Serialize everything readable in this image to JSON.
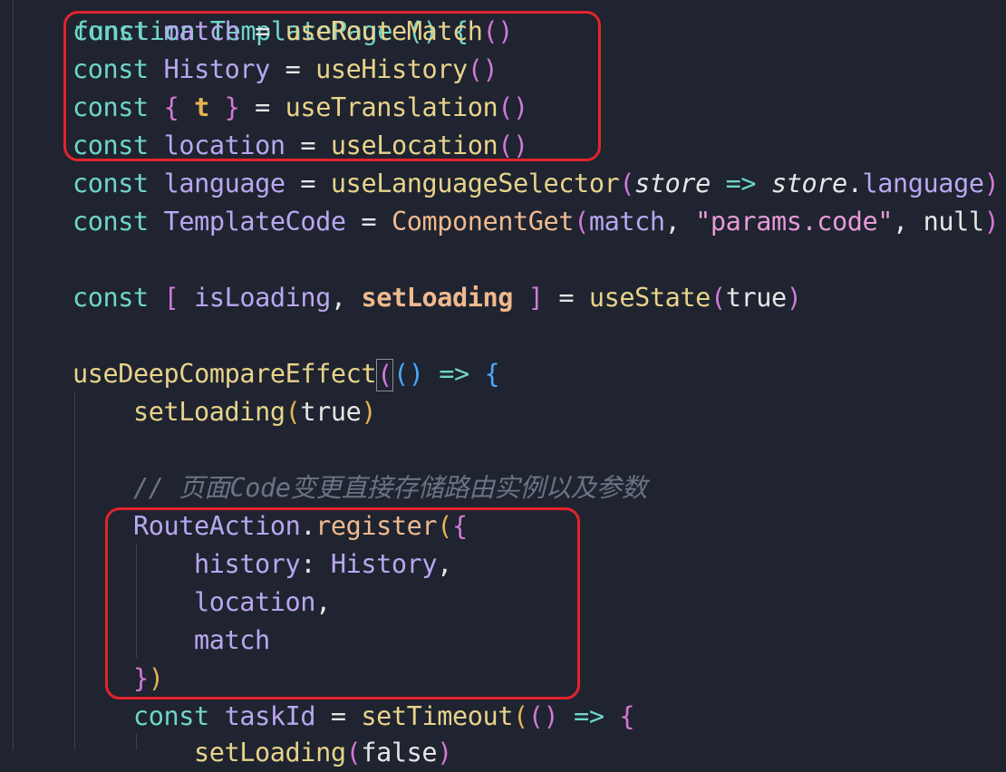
{
  "editor": {
    "top_partial": "function TemplatePage () {",
    "lines": [
      {
        "tokens": [
          "const ",
          "match",
          " = ",
          "useRouteMatch",
          "()"
        ]
      },
      {
        "tokens": [
          "const ",
          "History",
          " = ",
          "useHistory",
          "()"
        ]
      },
      {
        "tokens": [
          "const ",
          "{ ",
          "t",
          " }",
          " = ",
          "useTranslation",
          "()"
        ]
      },
      {
        "tokens": [
          "const ",
          "location",
          " = ",
          "useLocation",
          "()"
        ]
      },
      {
        "tokens": [
          "const ",
          "language",
          " = ",
          "useLanguageSelector",
          "(",
          "store",
          " => ",
          "store",
          ".",
          "language",
          ")"
        ]
      },
      {
        "tokens": [
          "const ",
          "TemplateCode",
          " = ",
          "ComponentGet",
          "(",
          "match",
          ", ",
          "\"params.code\"",
          ", ",
          "null",
          ")"
        ]
      },
      {
        "tokens": [
          "const ",
          "[ ",
          "isLoading",
          ", ",
          "setLoading",
          " ]",
          " = ",
          "useState",
          "(",
          "true",
          ")"
        ]
      },
      {
        "tokens": [
          "useDeepCompareEffect",
          "(",
          "()",
          " => ",
          "{"
        ]
      },
      {
        "tokens": [
          "setLoading",
          "(",
          "true",
          ")"
        ]
      },
      {
        "tokens": [
          "// 页面Code变更直接存储路由实例以及参数"
        ]
      },
      {
        "tokens": [
          "RouteAction",
          ".",
          "register",
          "(",
          "{"
        ]
      },
      {
        "tokens": [
          "history",
          ": ",
          "History",
          ","
        ]
      },
      {
        "tokens": [
          "location",
          ","
        ]
      },
      {
        "tokens": [
          "match"
        ]
      },
      {
        "tokens": [
          "}",
          ")"
        ]
      },
      {
        "tokens": [
          "const ",
          "taskId",
          " = ",
          "setTimeout",
          "(",
          "()",
          " => ",
          "{"
        ]
      },
      {
        "tokens": [
          "setLoading",
          "(",
          "false",
          ")"
        ]
      }
    ]
  },
  "colors": {
    "background": "#1f2430",
    "highlight_box": "#e3232b"
  }
}
